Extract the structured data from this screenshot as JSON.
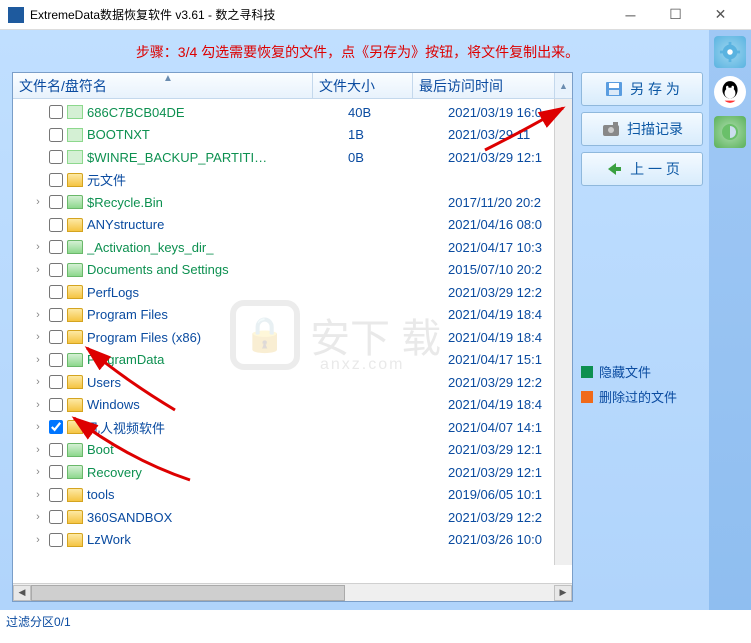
{
  "titlebar": {
    "title": "ExtremeData数据恢复软件 v3.61   - 数之寻科技"
  },
  "step_text": "步骤：3/4 勾选需要恢复的文件，点《另存为》按钮，将文件复制出来。",
  "columns": {
    "name": "文件名/盘符名",
    "size": "文件大小",
    "time": "最后访问时间"
  },
  "buttons": {
    "save_as": "另 存 为",
    "scan_log": "扫描记录",
    "prev_page": "上 一 页"
  },
  "legend": {
    "hidden": "隐藏文件",
    "deleted": "删除过的文件",
    "hidden_color": "#0d9050",
    "deleted_color": "#f06a1a"
  },
  "files": [
    {
      "exp": "",
      "indent": 1,
      "chk": false,
      "icon": "file",
      "hidden": true,
      "name": "686C7BCB04DE",
      "size": "40B",
      "time": "2021/03/19 16:0"
    },
    {
      "exp": "",
      "indent": 1,
      "chk": false,
      "icon": "file",
      "hidden": true,
      "name": "BOOTNXT",
      "size": "1B",
      "time": "2021/03/29 11"
    },
    {
      "exp": "",
      "indent": 1,
      "chk": false,
      "icon": "file",
      "hidden": true,
      "name": "$WINRE_BACKUP_PARTITI…",
      "size": "0B",
      "time": "2021/03/29 12:1"
    },
    {
      "exp": "",
      "indent": 1,
      "chk": false,
      "icon": "folder",
      "hidden": false,
      "name": "元文件",
      "size": "",
      "time": ""
    },
    {
      "exp": "›",
      "indent": 1,
      "chk": false,
      "icon": "folder",
      "hidden": true,
      "name": "$Recycle.Bin",
      "size": "",
      "time": "2017/11/20 20:2"
    },
    {
      "exp": "",
      "indent": 1,
      "chk": false,
      "icon": "folder",
      "hidden": false,
      "name": "ANYstructure",
      "size": "",
      "time": "2021/04/16 08:0"
    },
    {
      "exp": "›",
      "indent": 1,
      "chk": false,
      "icon": "folder",
      "hidden": true,
      "name": "_Activation_keys_dir_",
      "size": "",
      "time": "2021/04/17 10:3"
    },
    {
      "exp": "›",
      "indent": 1,
      "chk": false,
      "icon": "folder",
      "hidden": true,
      "name": "Documents and Settings",
      "size": "",
      "time": "2015/07/10 20:2"
    },
    {
      "exp": "",
      "indent": 1,
      "chk": false,
      "icon": "folder",
      "hidden": false,
      "name": "PerfLogs",
      "size": "",
      "time": "2021/03/29 12:2"
    },
    {
      "exp": "›",
      "indent": 1,
      "chk": false,
      "icon": "folder",
      "hidden": false,
      "name": "Program Files",
      "size": "",
      "time": "2021/04/19 18:4"
    },
    {
      "exp": "›",
      "indent": 1,
      "chk": false,
      "icon": "folder",
      "hidden": false,
      "name": "Program Files (x86)",
      "size": "",
      "time": "2021/04/19 18:4"
    },
    {
      "exp": "›",
      "indent": 1,
      "chk": false,
      "icon": "folder",
      "hidden": true,
      "name": "ProgramData",
      "size": "",
      "time": "2021/04/17 15:1"
    },
    {
      "exp": "›",
      "indent": 1,
      "chk": false,
      "icon": "folder",
      "hidden": false,
      "name": "Users",
      "size": "",
      "time": "2021/03/29 12:2"
    },
    {
      "exp": "›",
      "indent": 1,
      "chk": false,
      "icon": "folder",
      "hidden": false,
      "name": "Windows",
      "size": "",
      "time": "2021/04/19 18:4"
    },
    {
      "exp": "›",
      "indent": 1,
      "chk": true,
      "icon": "folder",
      "hidden": false,
      "name": "凡人视频软件",
      "size": "",
      "time": "2021/04/07 14:1"
    },
    {
      "exp": "›",
      "indent": 1,
      "chk": false,
      "icon": "folder",
      "hidden": true,
      "name": "Boot",
      "size": "",
      "time": "2021/03/29 12:1"
    },
    {
      "exp": "›",
      "indent": 1,
      "chk": false,
      "icon": "folder",
      "hidden": true,
      "name": "Recovery",
      "size": "",
      "time": "2021/03/29 12:1"
    },
    {
      "exp": "›",
      "indent": 1,
      "chk": false,
      "icon": "folder",
      "hidden": false,
      "name": "tools",
      "size": "",
      "time": "2019/06/05 10:1"
    },
    {
      "exp": "›",
      "indent": 1,
      "chk": false,
      "icon": "folder",
      "hidden": false,
      "name": "360SANDBOX",
      "size": "",
      "time": "2021/03/29 12:2"
    },
    {
      "exp": "›",
      "indent": 1,
      "chk": false,
      "icon": "folder",
      "hidden": false,
      "name": "LzWork",
      "size": "",
      "time": "2021/03/26 10:0"
    }
  ],
  "status": "过滤分区0/1",
  "watermark": {
    "main": "安下 载",
    "sub": "anxz.com"
  }
}
